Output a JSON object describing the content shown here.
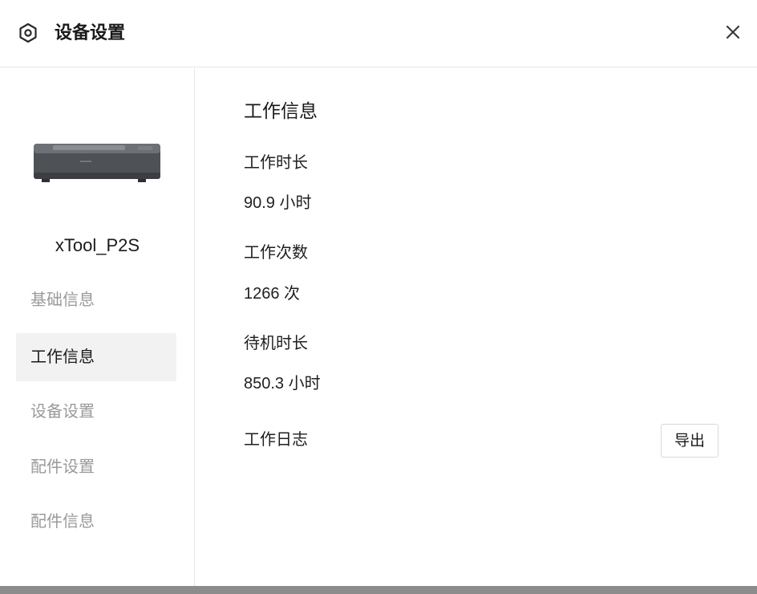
{
  "header": {
    "title": "设备设置",
    "icon": "settings-hexagon-icon",
    "close_icon": "close-icon"
  },
  "sidebar": {
    "device_name": "xTool_P2S",
    "device_image": "laser-engraver-device-image",
    "items": [
      {
        "label": "基础信息",
        "active": false
      },
      {
        "label": "工作信息",
        "active": true
      },
      {
        "label": "设备设置",
        "active": false
      },
      {
        "label": "配件设置",
        "active": false
      },
      {
        "label": "配件信息",
        "active": false
      }
    ]
  },
  "main": {
    "section_title": "工作信息",
    "work_duration": {
      "label": "工作时长",
      "value": "90.9 小时"
    },
    "work_count": {
      "label": "工作次数",
      "value": "1266 次"
    },
    "standby_duration": {
      "label": "待机时长",
      "value": "850.3 小时"
    },
    "work_log": {
      "label": "工作日志",
      "export_label": "导出"
    }
  },
  "colors": {
    "active_nav_bg": "#f2f2f2",
    "inactive_nav_text": "#9a9a9a",
    "border": "#e6e6e6"
  }
}
